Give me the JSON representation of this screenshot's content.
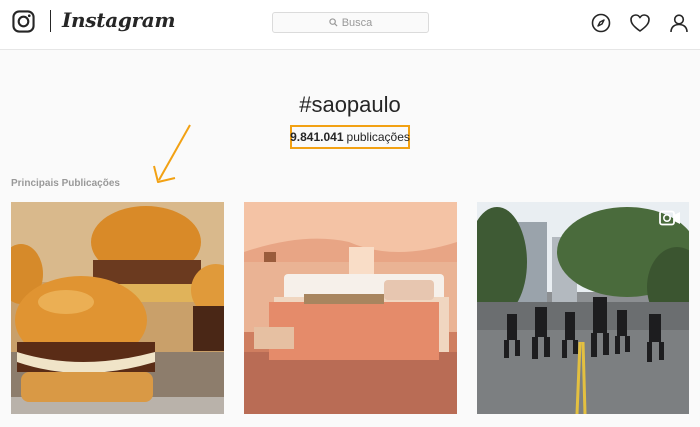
{
  "header": {
    "brand": "Instagram",
    "search": {
      "placeholder": "Busca"
    },
    "nav_icons": [
      "compass-icon",
      "heart-icon",
      "user-icon"
    ]
  },
  "hashtag": {
    "title": "#saopaulo",
    "count": "9.841.041",
    "count_label": "publicações"
  },
  "section": {
    "title": "Principais Publicações"
  },
  "posts": [
    {
      "subject": "burgers-photo",
      "type": "image"
    },
    {
      "subject": "bedroom-tent-photo",
      "type": "image"
    },
    {
      "subject": "street-dancers-video",
      "type": "video"
    }
  ],
  "colors": {
    "highlight": "#f2a113",
    "text": "#262626",
    "muted": "#999999",
    "background": "#fafafa"
  }
}
